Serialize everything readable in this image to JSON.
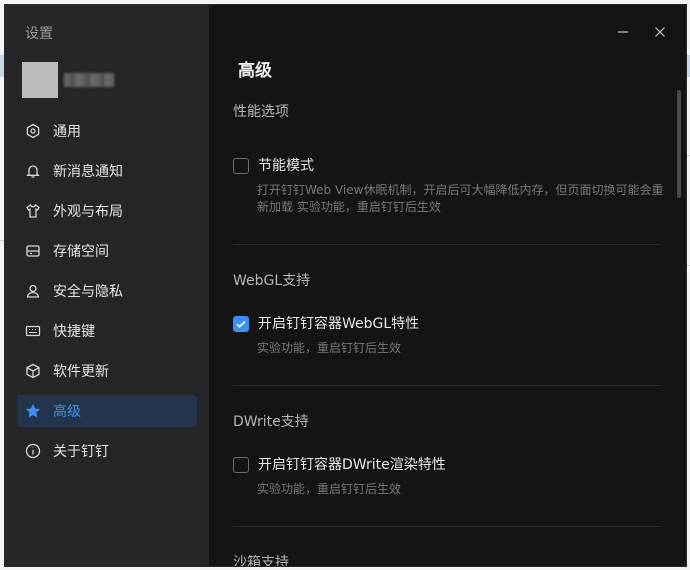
{
  "sidebar": {
    "title": "设置",
    "items": [
      {
        "label": "通用",
        "icon": "settings-icon"
      },
      {
        "label": "新消息通知",
        "icon": "bell-icon"
      },
      {
        "label": "外观与布局",
        "icon": "shirt-icon"
      },
      {
        "label": "存储空间",
        "icon": "storage-icon"
      },
      {
        "label": "安全与隐私",
        "icon": "user-icon"
      },
      {
        "label": "快捷键",
        "icon": "keyboard-icon"
      },
      {
        "label": "软件更新",
        "icon": "box-icon"
      },
      {
        "label": "高级",
        "icon": "star-icon",
        "active": true
      },
      {
        "label": "关于钉钉",
        "icon": "info-icon"
      }
    ]
  },
  "main": {
    "title": "高级",
    "sections": [
      {
        "title": "性能选项",
        "option": {
          "label": "节能模式",
          "checked": false,
          "desc": "打开钉钉Web View休眠机制，开启后可大幅降低内存，但页面切换可能会重新加载 实验功能，重启钉钉后生效"
        }
      },
      {
        "title": "WebGL支持",
        "option": {
          "label": "开启钉钉容器WebGL特性",
          "checked": true,
          "desc": "实验功能，重启钉钉后生效"
        }
      },
      {
        "title": "DWrite支持",
        "option": {
          "label": "开启钉钉容器DWrite渲染特性",
          "checked": false,
          "desc": "实验功能，重启钉钉后生效"
        }
      },
      {
        "title": "沙箱支持"
      }
    ]
  },
  "colors": {
    "accent": "#3d8ff5",
    "sidebar_bg": "#262628",
    "main_bg": "#141415",
    "active_bg": "#23354c"
  }
}
